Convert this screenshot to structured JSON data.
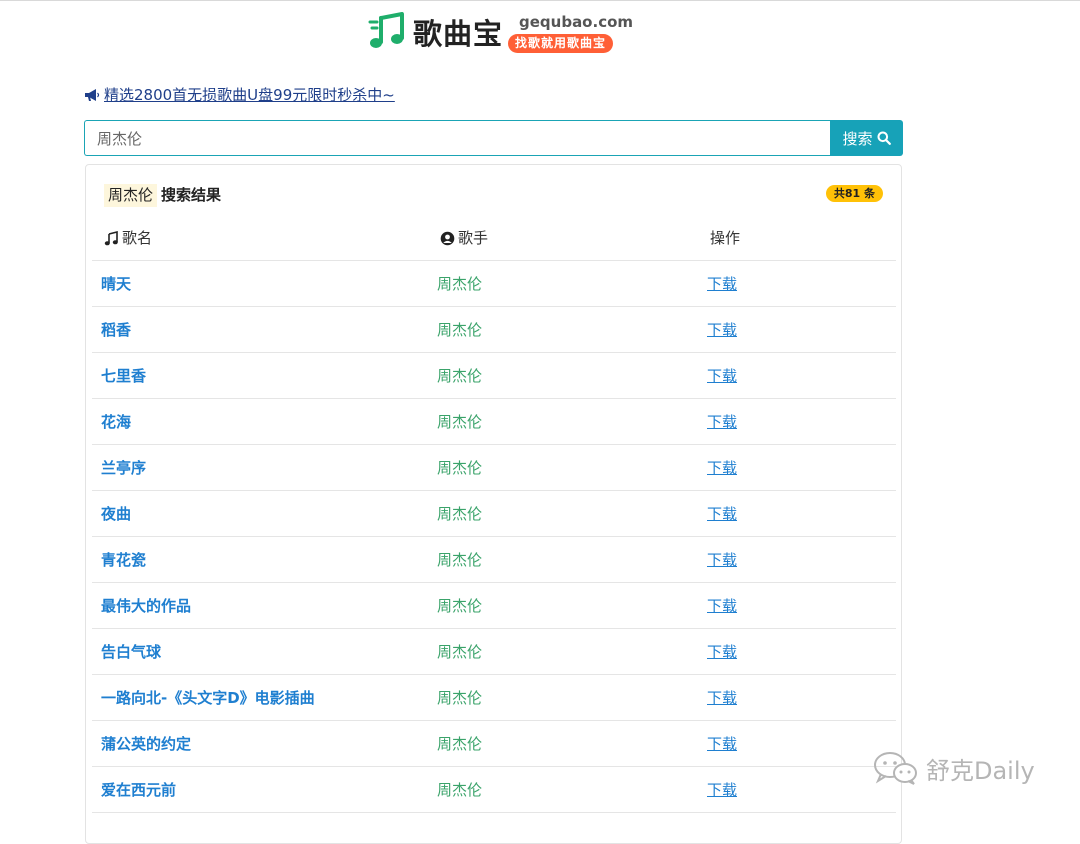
{
  "header": {
    "logo_name": "歌曲宝",
    "logo_domain": "gequbao.com",
    "logo_slogan": "找歌就用歌曲宝",
    "logo_icon": "music-note-icon",
    "brand_color": "#1fae6b",
    "slogan_color": "#ff5f36"
  },
  "promo": {
    "icon": "megaphone-icon",
    "text": "精选2800首无损歌曲U盘99元限时秒杀中~"
  },
  "search": {
    "value": "周杰伦",
    "button_label": "搜索",
    "button_icon": "search-icon",
    "accent": "#17a2b8"
  },
  "results": {
    "query_tag": "周杰伦",
    "label": "搜索结果",
    "count_badge": "共81 条",
    "columns": {
      "name": "歌名",
      "artist": "歌手",
      "action": "操作"
    },
    "rows": [
      {
        "title": "晴天",
        "artist": "周杰伦",
        "action": "下载"
      },
      {
        "title": "稻香",
        "artist": "周杰伦",
        "action": "下载"
      },
      {
        "title": "七里香",
        "artist": "周杰伦",
        "action": "下载"
      },
      {
        "title": "花海",
        "artist": "周杰伦",
        "action": "下载"
      },
      {
        "title": "兰亭序",
        "artist": "周杰伦",
        "action": "下载"
      },
      {
        "title": "夜曲",
        "artist": "周杰伦",
        "action": "下载"
      },
      {
        "title": "青花瓷",
        "artist": "周杰伦",
        "action": "下载"
      },
      {
        "title": "最伟大的作品",
        "artist": "周杰伦",
        "action": "下载"
      },
      {
        "title": "告白气球",
        "artist": "周杰伦",
        "action": "下载"
      },
      {
        "title": "一路向北-《头文字D》电影插曲",
        "artist": "周杰伦",
        "action": "下载"
      },
      {
        "title": "蒲公英的约定",
        "artist": "周杰伦",
        "action": "下载"
      },
      {
        "title": "爱在西元前",
        "artist": "周杰伦",
        "action": "下载"
      }
    ]
  },
  "watermark": {
    "text": "舒克Daily",
    "icon": "wechat-icon"
  }
}
